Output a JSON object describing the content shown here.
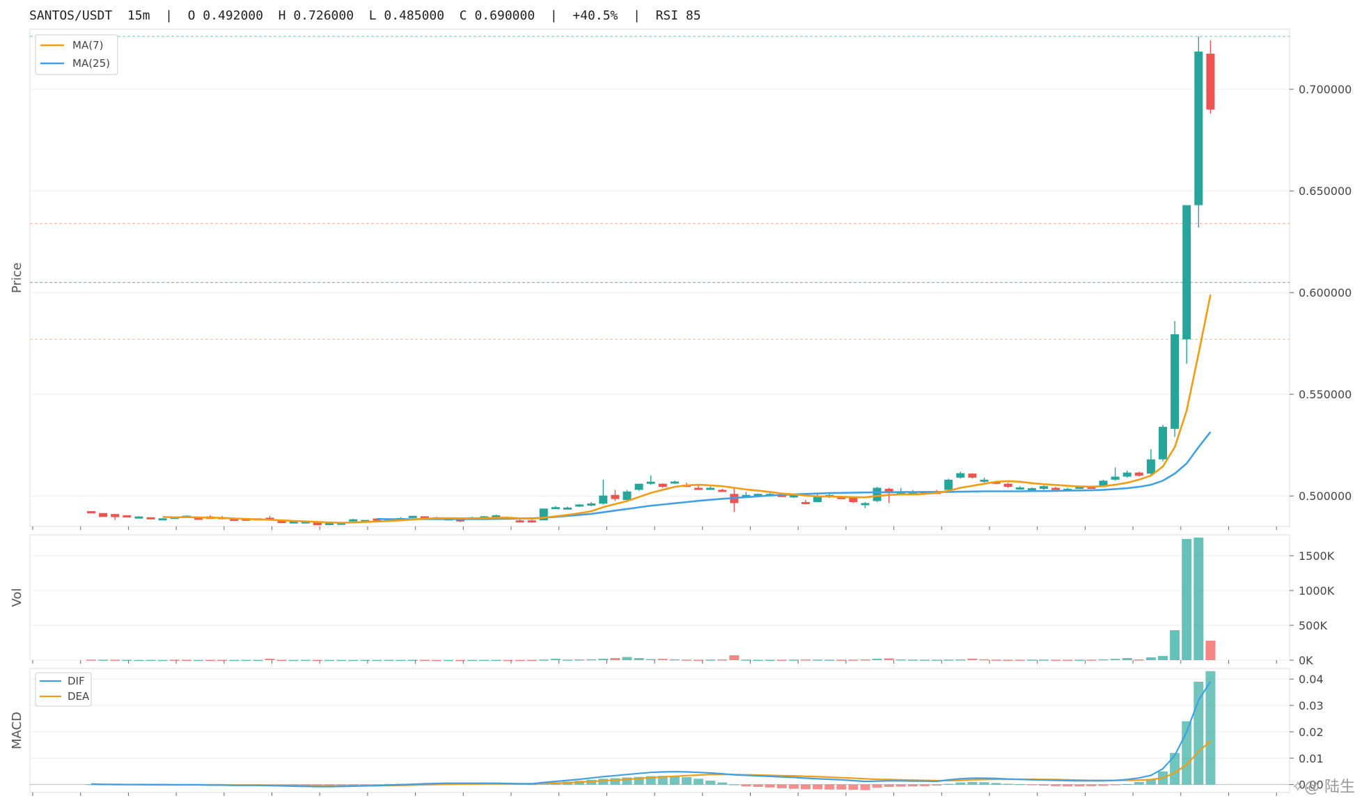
{
  "header": {
    "symbol": "SANTOS/USDT",
    "interval": "15m",
    "open": "O 0.492000",
    "high": "H 0.726000",
    "low": "L 0.485000",
    "close": "C 0.690000",
    "change": "+40.5%",
    "rsi": "RSI 85"
  },
  "watermark": "✧@ 陆生",
  "colors": {
    "up": "#26a69a",
    "down": "#ef5350",
    "ma7": "#f39c12",
    "ma25": "#3fa0e8",
    "dif": "#3fa0e8",
    "dea": "#f39c12"
  },
  "chart_data": [
    {
      "type": "candlestick",
      "ylabel": "Price",
      "ylim": [
        0.485,
        0.7295
      ],
      "yticks": [
        "0.500000",
        "0.550000",
        "0.600000",
        "0.650000",
        "0.700000"
      ],
      "legend": {
        "placement": "top-left",
        "entries": [
          "MA(7)",
          "MA(25)"
        ]
      },
      "reference_lines": [
        0.726,
        0.634,
        0.605,
        0.577
      ],
      "ohlc": [
        [
          0.4925,
          0.4925,
          0.4918,
          0.4918
        ],
        [
          0.4916,
          0.4916,
          0.4897,
          0.4897
        ],
        [
          0.4911,
          0.4911,
          0.4882,
          0.4896
        ],
        [
          0.4905,
          0.4905,
          0.4897,
          0.4897
        ],
        [
          0.4898,
          0.49,
          0.4895,
          0.4899
        ],
        [
          0.4895,
          0.4895,
          0.4891,
          0.4891
        ],
        [
          0.489,
          0.489,
          0.4887,
          0.489
        ],
        [
          0.4892,
          0.4898,
          0.4886,
          0.4897
        ],
        [
          0.4902,
          0.4905,
          0.49,
          0.4903
        ],
        [
          0.4893,
          0.4893,
          0.4887,
          0.4887
        ],
        [
          0.4899,
          0.4905,
          0.4887,
          0.4887
        ],
        [
          0.4896,
          0.4901,
          0.4886,
          0.4889
        ],
        [
          0.4888,
          0.4888,
          0.4877,
          0.4877
        ],
        [
          0.489,
          0.489,
          0.4878,
          0.4878
        ],
        [
          0.489,
          0.489,
          0.4884,
          0.4884
        ],
        [
          0.4893,
          0.4902,
          0.488,
          0.4883
        ],
        [
          0.488,
          0.488,
          0.4867,
          0.4867
        ],
        [
          0.4868,
          0.4875,
          0.4865,
          0.4875
        ],
        [
          0.4865,
          0.4877,
          0.4865,
          0.4875
        ],
        [
          0.487,
          0.487,
          0.4856,
          0.4856
        ],
        [
          0.486,
          0.4867,
          0.4858,
          0.4867
        ],
        [
          0.4858,
          0.487,
          0.4858,
          0.487
        ],
        [
          0.488,
          0.4888,
          0.488,
          0.4885
        ],
        [
          0.4875,
          0.4882,
          0.4875,
          0.4882
        ],
        [
          0.4889,
          0.489,
          0.4877,
          0.4878
        ],
        [
          0.488,
          0.489,
          0.4876,
          0.4887
        ],
        [
          0.4882,
          0.4895,
          0.4882,
          0.4891
        ],
        [
          0.4896,
          0.4902,
          0.4894,
          0.4902
        ],
        [
          0.49,
          0.49,
          0.4892,
          0.4897
        ],
        [
          0.4895,
          0.4898,
          0.4888,
          0.4892
        ],
        [
          0.489,
          0.489,
          0.4884,
          0.489
        ],
        [
          0.4885,
          0.4885,
          0.4872,
          0.4875
        ],
        [
          0.489,
          0.4898,
          0.4888,
          0.4895
        ],
        [
          0.49,
          0.4901,
          0.4893,
          0.49
        ],
        [
          0.4905,
          0.4908,
          0.49,
          0.4905
        ],
        [
          0.4895,
          0.4899,
          0.4885,
          0.489
        ],
        [
          0.488,
          0.4885,
          0.4874,
          0.4877
        ],
        [
          0.488,
          0.4883,
          0.4868,
          0.4872
        ],
        [
          0.488,
          0.4938,
          0.488,
          0.4938
        ],
        [
          0.494,
          0.495,
          0.4937,
          0.4945
        ],
        [
          0.494,
          0.4948,
          0.4936,
          0.4943
        ],
        [
          0.495,
          0.496,
          0.4945,
          0.4958
        ],
        [
          0.4958,
          0.497,
          0.495,
          0.4963
        ],
        [
          0.4962,
          0.508,
          0.4958,
          0.5002
        ],
        [
          0.5005,
          0.503,
          0.4975,
          0.4985
        ],
        [
          0.498,
          0.503,
          0.498,
          0.5022
        ],
        [
          0.503,
          0.506,
          0.5025,
          0.506
        ],
        [
          0.506,
          0.51,
          0.5055,
          0.507
        ],
        [
          0.506,
          0.5062,
          0.504,
          0.5045
        ],
        [
          0.507,
          0.5075,
          0.506,
          0.5071
        ],
        [
          0.5055,
          0.5065,
          0.5045,
          0.505
        ],
        [
          0.504,
          0.5052,
          0.5035,
          0.5035
        ],
        [
          0.504,
          0.5048,
          0.503,
          0.504
        ],
        [
          0.503,
          0.5035,
          0.502,
          0.5025
        ],
        [
          0.501,
          0.504,
          0.4922,
          0.4965
        ],
        [
          0.5,
          0.502,
          0.5,
          0.5005
        ],
        [
          0.5005,
          0.5012,
          0.5,
          0.501
        ],
        [
          0.501,
          0.502,
          0.5005,
          0.501
        ],
        [
          0.5005,
          0.5015,
          0.4995,
          0.5
        ],
        [
          0.5,
          0.5012,
          0.499,
          0.5003
        ],
        [
          0.497,
          0.498,
          0.4958,
          0.4965
        ],
        [
          0.497,
          0.501,
          0.4968,
          0.5
        ],
        [
          0.4995,
          0.501,
          0.499,
          0.5005
        ],
        [
          0.4995,
          0.5,
          0.4988,
          0.4992
        ],
        [
          0.4995,
          0.4995,
          0.4965,
          0.497
        ],
        [
          0.4962,
          0.497,
          0.494,
          0.4965
        ],
        [
          0.4975,
          0.5045,
          0.497,
          0.504
        ],
        [
          0.5035,
          0.504,
          0.4965,
          0.502
        ],
        [
          0.5015,
          0.504,
          0.501,
          0.5018
        ],
        [
          0.5015,
          0.503,
          0.501,
          0.502
        ],
        [
          0.5012,
          0.502,
          0.5005,
          0.5018
        ],
        [
          0.502,
          0.503,
          0.501,
          0.5018
        ],
        [
          0.503,
          0.5085,
          0.5025,
          0.508
        ],
        [
          0.509,
          0.512,
          0.5085,
          0.5112
        ],
        [
          0.511,
          0.5112,
          0.5085,
          0.509
        ],
        [
          0.507,
          0.509,
          0.5065,
          0.508
        ],
        [
          0.507,
          0.5075,
          0.506,
          0.5065
        ],
        [
          0.506,
          0.5065,
          0.504,
          0.5045
        ],
        [
          0.504,
          0.5048,
          0.5035,
          0.5042
        ],
        [
          0.5035,
          0.5042,
          0.503,
          0.5038
        ],
        [
          0.5035,
          0.5052,
          0.503,
          0.5048
        ],
        [
          0.504,
          0.5045,
          0.503,
          0.5038
        ],
        [
          0.5035,
          0.504,
          0.503,
          0.5035
        ],
        [
          0.504,
          0.5048,
          0.5035,
          0.5045
        ],
        [
          0.5045,
          0.505,
          0.5035,
          0.504
        ],
        [
          0.505,
          0.508,
          0.5045,
          0.5075
        ],
        [
          0.508,
          0.514,
          0.5075,
          0.5095
        ],
        [
          0.5095,
          0.5125,
          0.509,
          0.5115
        ],
        [
          0.5115,
          0.512,
          0.5095,
          0.51
        ],
        [
          0.511,
          0.523,
          0.5105,
          0.518
        ],
        [
          0.518,
          0.535,
          0.517,
          0.534
        ],
        [
          0.533,
          0.586,
          0.529,
          0.5795
        ],
        [
          0.577,
          0.642,
          0.565,
          0.643
        ],
        [
          0.643,
          0.726,
          0.632,
          0.7185
        ],
        [
          0.7175,
          0.724,
          0.688,
          0.69
        ]
      ],
      "ma7": [
        null,
        null,
        null,
        null,
        null,
        null,
        0.4897,
        0.4895,
        0.4896,
        0.4895,
        0.4893,
        0.4892,
        0.4889,
        0.4887,
        0.4885,
        0.4883,
        0.488,
        0.4877,
        0.4875,
        0.4872,
        0.487,
        0.4868,
        0.487,
        0.4872,
        0.4874,
        0.4877,
        0.488,
        0.4884,
        0.4888,
        0.489,
        0.4891,
        0.489,
        0.489,
        0.4891,
        0.4893,
        0.4893,
        0.489,
        0.4888,
        0.4893,
        0.49,
        0.4907,
        0.4915,
        0.4925,
        0.4945,
        0.496,
        0.4975,
        0.4995,
        0.5015,
        0.503,
        0.5045,
        0.5052,
        0.5055,
        0.5052,
        0.5048,
        0.504,
        0.5032,
        0.5026,
        0.502,
        0.5012,
        0.5008,
        0.5002,
        0.4998,
        0.4997,
        0.4996,
        0.4994,
        0.4993,
        0.5,
        0.5005,
        0.5008,
        0.5008,
        0.501,
        0.5015,
        0.5025,
        0.504,
        0.505,
        0.506,
        0.507,
        0.5073,
        0.507,
        0.5063,
        0.5058,
        0.5054,
        0.505,
        0.5047,
        0.5046,
        0.5048,
        0.5055,
        0.5065,
        0.508,
        0.51,
        0.5145,
        0.524,
        0.542,
        0.57,
        0.599
      ],
      "ma25": [
        null,
        null,
        null,
        null,
        null,
        null,
        null,
        null,
        null,
        null,
        null,
        null,
        null,
        null,
        null,
        null,
        null,
        null,
        null,
        null,
        null,
        null,
        null,
        null,
        0.4887,
        0.4886,
        0.4886,
        0.4886,
        0.4886,
        0.4886,
        0.4886,
        0.4886,
        0.4886,
        0.4886,
        0.4887,
        0.4888,
        0.4889,
        0.489,
        0.4893,
        0.4897,
        0.4902,
        0.4907,
        0.4912,
        0.492,
        0.4928,
        0.4936,
        0.4944,
        0.4952,
        0.4958,
        0.4964,
        0.497,
        0.4976,
        0.4981,
        0.4986,
        0.499,
        0.4994,
        0.4998,
        0.5002,
        0.5005,
        0.5008,
        0.501,
        0.5012,
        0.5014,
        0.5015,
        0.5016,
        0.5017,
        0.5018,
        0.5018,
        0.5019,
        0.5019,
        0.502,
        0.502,
        0.502,
        0.5021,
        0.5022,
        0.5023,
        0.5023,
        0.5023,
        0.5023,
        0.5024,
        0.5024,
        0.5025,
        0.5026,
        0.5027,
        0.5028,
        0.503,
        0.5034,
        0.5038,
        0.5045,
        0.5055,
        0.5075,
        0.511,
        0.516,
        0.524,
        0.5315
      ]
    },
    {
      "type": "bar",
      "ylabel": "Vol",
      "ylim": [
        0,
        1800
      ],
      "yticks": [
        "0K",
        "500K",
        "1000K",
        "1500K"
      ],
      "values": [
        8,
        6,
        6,
        5,
        3,
        4,
        3,
        6,
        5,
        3,
        5,
        5,
        3,
        4,
        4,
        20,
        5,
        3,
        4,
        4,
        3,
        3,
        3,
        4,
        3,
        4,
        4,
        5,
        5,
        3,
        3,
        3,
        3,
        4,
        4,
        3,
        3,
        4,
        8,
        20,
        8,
        10,
        12,
        20,
        30,
        45,
        30,
        15,
        18,
        12,
        8,
        6,
        8,
        10,
        70,
        8,
        5,
        5,
        6,
        8,
        10,
        8,
        6,
        6,
        8,
        10,
        20,
        25,
        10,
        8,
        6,
        6,
        8,
        10,
        22,
        12,
        8,
        6,
        6,
        8,
        8,
        6,
        6,
        6,
        8,
        12,
        18,
        30,
        10,
        40,
        60,
        430,
        1740,
        1760,
        280
      ],
      "down": [
        1,
        0,
        1,
        0,
        0,
        0,
        0,
        1,
        1,
        0,
        1,
        1,
        0,
        0,
        0,
        1,
        1,
        0,
        0,
        1,
        0,
        0,
        0,
        0,
        0,
        0,
        0,
        0,
        1,
        1,
        0,
        1,
        0,
        0,
        0,
        1,
        1,
        1,
        0,
        0,
        0,
        0,
        0,
        0,
        1,
        0,
        0,
        0,
        1,
        0,
        1,
        1,
        0,
        1,
        1,
        0,
        0,
        0,
        1,
        0,
        1,
        0,
        0,
        1,
        1,
        1,
        0,
        1,
        0,
        0,
        0,
        0,
        0,
        0,
        1,
        1,
        1,
        1,
        1,
        0,
        0,
        1,
        1,
        0,
        1,
        0,
        0,
        0,
        1,
        0,
        0,
        0,
        0,
        0,
        1
      ]
    },
    {
      "type": "bar+line",
      "ylabel": "MACD",
      "ylim": [
        -0.003,
        0.044
      ],
      "yticks": [
        "0.00",
        "0.01",
        "0.02",
        "0.03",
        "0.04"
      ],
      "legend": {
        "placement": "top-left",
        "entries": [
          "DIF",
          "DEA"
        ]
      },
      "hist": [
        0.0001,
        0.0,
        0.0,
        0.0,
        0.0,
        0.0,
        0.0,
        0.0,
        0.0,
        0.0,
        -0.0001,
        -0.0001,
        -0.0001,
        -0.0001,
        -0.0001,
        -0.0001,
        -0.0002,
        -0.0003,
        -0.0004,
        -0.0005,
        -0.0004,
        -0.0003,
        -0.0002,
        -0.0001,
        0.0,
        0.0002,
        0.0003,
        0.0004,
        0.0005,
        0.0006,
        0.0006,
        0.0005,
        0.0004,
        0.0004,
        0.0004,
        0.0003,
        0.0002,
        0.0001,
        0.0005,
        0.0008,
        0.0011,
        0.0014,
        0.0018,
        0.0022,
        0.0024,
        0.0027,
        0.0029,
        0.0032,
        0.0033,
        0.0032,
        0.0028,
        0.0022,
        0.0015,
        0.0008,
        0.0,
        -0.0007,
        -0.0009,
        -0.0011,
        -0.0014,
        -0.0016,
        -0.0018,
        -0.0018,
        -0.0019,
        -0.0019,
        -0.002,
        -0.0021,
        -0.0012,
        -0.0009,
        -0.0008,
        -0.0007,
        -0.0006,
        -0.0004,
        0.0003,
        0.0008,
        0.001,
        0.0009,
        0.0006,
        0.0003,
        0.0001,
        -0.0002,
        -0.0004,
        -0.0006,
        -0.0007,
        -0.0007,
        -0.0006,
        -0.0005,
        -0.0002,
        0.0002,
        0.001,
        0.002,
        0.005,
        0.012,
        0.024,
        0.039,
        0.043
      ],
      "dif": [
        0.0002,
        0.0001,
        0.0,
        0.0,
        0.0,
        -0.0001,
        -0.0001,
        -0.0001,
        -0.0001,
        -0.0001,
        -0.0002,
        -0.0002,
        -0.0003,
        -0.0003,
        -0.0003,
        -0.0004,
        -0.0005,
        -0.0006,
        -0.0007,
        -0.0008,
        -0.0008,
        -0.0007,
        -0.0006,
        -0.0005,
        -0.0004,
        -0.0002,
        -0.0001,
        0.0001,
        0.0003,
        0.0004,
        0.0005,
        0.0005,
        0.0005,
        0.0005,
        0.0005,
        0.0004,
        0.0003,
        0.0003,
        0.0008,
        0.0012,
        0.0016,
        0.002,
        0.0025,
        0.003,
        0.0034,
        0.0038,
        0.0042,
        0.0046,
        0.0048,
        0.0049,
        0.0048,
        0.0046,
        0.0044,
        0.0041,
        0.0037,
        0.0035,
        0.0033,
        0.0031,
        0.0029,
        0.0027,
        0.0024,
        0.0022,
        0.002,
        0.0018,
        0.0015,
        0.0012,
        0.0013,
        0.0014,
        0.0014,
        0.0013,
        0.0013,
        0.0012,
        0.0018,
        0.0022,
        0.0024,
        0.0024,
        0.0023,
        0.0021,
        0.002,
        0.0018,
        0.0017,
        0.0016,
        0.0015,
        0.0014,
        0.0014,
        0.0014,
        0.0016,
        0.0019,
        0.0025,
        0.0035,
        0.006,
        0.011,
        0.02,
        0.032,
        0.039
      ],
      "dea": [
        0.0001,
        0.0001,
        0.0001,
        0.0,
        0.0,
        0.0,
        0.0,
        -0.0001,
        -0.0001,
        -0.0001,
        -0.0001,
        -0.0001,
        -0.0002,
        -0.0002,
        -0.0002,
        -0.0003,
        -0.0003,
        -0.0004,
        -0.0004,
        -0.0005,
        -0.0005,
        -0.0005,
        -0.0005,
        -0.0005,
        -0.0004,
        -0.0004,
        -0.0003,
        -0.0002,
        -0.0001,
        0.0,
        0.0001,
        0.0002,
        0.0002,
        0.0003,
        0.0003,
        0.0003,
        0.0003,
        0.0003,
        0.0004,
        0.0005,
        0.0007,
        0.0009,
        0.0012,
        0.0014,
        0.0017,
        0.002,
        0.0023,
        0.0026,
        0.0029,
        0.0031,
        0.0034,
        0.0036,
        0.0038,
        0.0038,
        0.0038,
        0.0037,
        0.0036,
        0.0035,
        0.0034,
        0.0033,
        0.0031,
        0.003,
        0.0028,
        0.0026,
        0.0024,
        0.0022,
        0.002,
        0.0019,
        0.0018,
        0.0017,
        0.0016,
        0.0015,
        0.0015,
        0.0016,
        0.0018,
        0.0019,
        0.002,
        0.002,
        0.002,
        0.002,
        0.0019,
        0.0019,
        0.0018,
        0.0017,
        0.0016,
        0.0016,
        0.0016,
        0.0016,
        0.0017,
        0.0019,
        0.0025,
        0.0045,
        0.0075,
        0.0125,
        0.0165
      ]
    }
  ]
}
